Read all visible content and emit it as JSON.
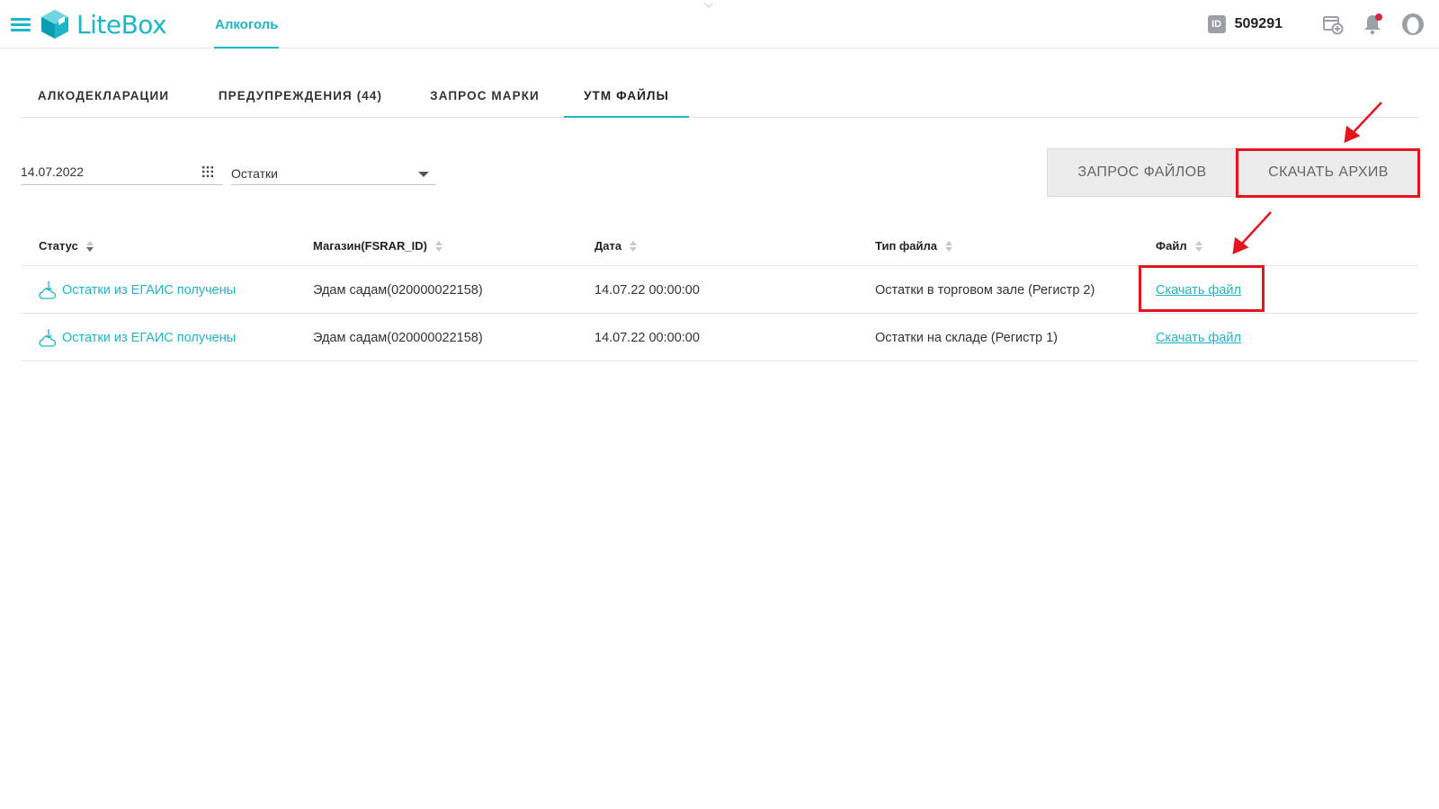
{
  "header": {
    "logo_text": "LiteBox",
    "nav_active": "Алкоголь",
    "account_id_label": "ID",
    "account_id": "509291"
  },
  "tabs": [
    {
      "label": "АЛКОДЕКЛАРАЦИИ",
      "active": false
    },
    {
      "label": "ПРЕДУПРЕЖДЕНИЯ (44)",
      "active": false
    },
    {
      "label": "ЗАПРОС МАРКИ",
      "active": false
    },
    {
      "label": "УТМ ФАЙЛЫ",
      "active": true
    }
  ],
  "filters": {
    "date": "14.07.2022",
    "type": "Остатки"
  },
  "buttons": {
    "request_files": "ЗАПРОС ФАЙЛОВ",
    "download_archive": "СКАЧАТЬ АРХИВ"
  },
  "table": {
    "columns": [
      "Статус",
      "Магазин(FSRAR_ID)",
      "Дата",
      "Тип файла",
      "Файл"
    ],
    "rows": [
      {
        "status": "Остатки из ЕГАИС получены",
        "store": "Эдам садам(020000022158)",
        "date": "14.07.22 00:00:00",
        "file_type": "Остатки в торговом зале (Регистр 2)",
        "file": "Скачать файл"
      },
      {
        "status": "Остатки из ЕГАИС получены",
        "store": "Эдам садам(020000022158)",
        "date": "14.07.22 00:00:00",
        "file_type": "Остатки на складе (Регистр 1)",
        "file": "Скачать файл"
      }
    ]
  },
  "colors": {
    "accent": "#1bb7c9",
    "annotation": "#e3151f",
    "notification_dot": "#e2203b"
  },
  "icons": [
    "menu-icon",
    "litebox-logo-icon",
    "id-icon",
    "store-add-icon",
    "bell-icon",
    "user-icon",
    "calendar-icon",
    "chevron-down-icon",
    "sort-icon",
    "cloud-download-icon"
  ]
}
